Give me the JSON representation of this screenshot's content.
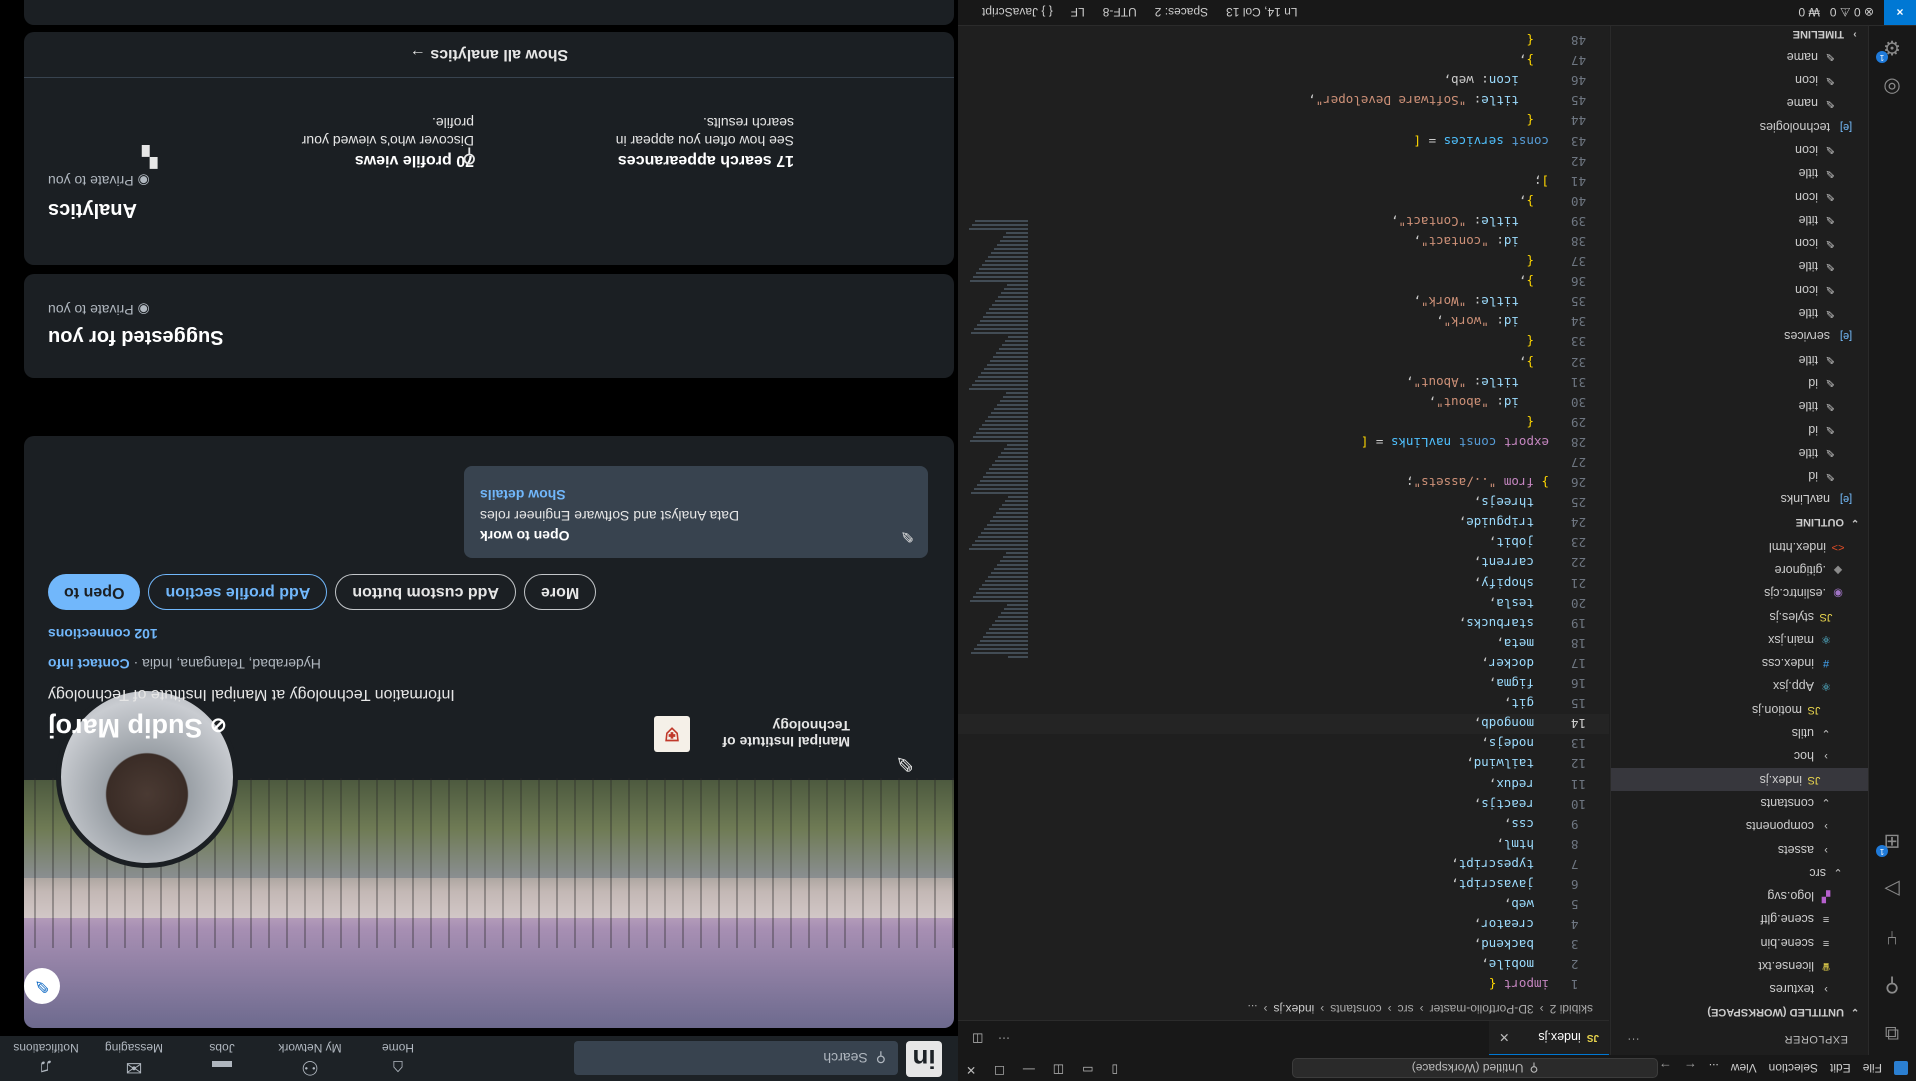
{
  "vscode": {
    "menu": [
      "File",
      "Edit",
      "Selection",
      "View",
      "..."
    ],
    "search_text": "Untitled (Workspace)",
    "explorer_title": "EXPLORER",
    "workspace_title": "UNTITLED (WORKSPACE)",
    "file_tree": [
      {
        "label": "textures",
        "icon": "chevron-right",
        "indent": 2
      },
      {
        "label": "license.txt",
        "icon": "license-icon",
        "indent": 2
      },
      {
        "label": "scene.bin",
        "icon": "file-lines-icon",
        "indent": 2
      },
      {
        "label": "scene.gltf",
        "icon": "file-lines-icon",
        "indent": 2
      },
      {
        "label": "logo.svg",
        "icon": "svg-icon",
        "indent": 2
      },
      {
        "label": "src",
        "icon": "chevron-down",
        "indent": 1
      },
      {
        "label": "assets",
        "icon": "chevron-right",
        "indent": 2
      },
      {
        "label": "components",
        "icon": "chevron-right",
        "indent": 2
      },
      {
        "label": "constants",
        "icon": "chevron-down",
        "indent": 2
      },
      {
        "label": "index.js",
        "icon": "js-icon",
        "indent": 3,
        "selected": true
      },
      {
        "label": "hoc",
        "icon": "chevron-right",
        "indent": 2
      },
      {
        "label": "utils",
        "icon": "chevron-down",
        "indent": 2
      },
      {
        "label": "motion.js",
        "icon": "js-icon",
        "indent": 3
      },
      {
        "label": "App.jsx",
        "icon": "react-icon",
        "indent": 2
      },
      {
        "label": "index.css",
        "icon": "css-icon",
        "indent": 2
      },
      {
        "label": "main.jsx",
        "icon": "react-icon",
        "indent": 2
      },
      {
        "label": "styles.js",
        "icon": "js-icon",
        "indent": 2
      },
      {
        "label": ".eslintrc.cjs",
        "icon": "eslint-icon",
        "indent": 1
      },
      {
        "label": ".gitignore",
        "icon": "git-icon",
        "indent": 1
      },
      {
        "label": "index.html",
        "icon": "html-icon",
        "indent": 1
      }
    ],
    "outline_title": "OUTLINE",
    "outline": [
      {
        "label": "navLinks",
        "type": "group"
      },
      {
        "label": "id"
      },
      {
        "label": "title"
      },
      {
        "label": "id"
      },
      {
        "label": "title"
      },
      {
        "label": "id"
      },
      {
        "label": "title"
      },
      {
        "label": "services",
        "type": "group"
      },
      {
        "label": "title"
      },
      {
        "label": "icon"
      },
      {
        "label": "title"
      },
      {
        "label": "icon"
      },
      {
        "label": "title"
      },
      {
        "label": "icon"
      },
      {
        "label": "title"
      },
      {
        "label": "icon"
      },
      {
        "label": "technologies",
        "type": "group"
      },
      {
        "label": "name"
      },
      {
        "label": "icon"
      },
      {
        "label": "name"
      }
    ],
    "timeline_title": "TIMELINE",
    "tab_label": "index.js",
    "tab_type": "JS",
    "breadcrumb": [
      "skibidi 2",
      "3D-Portfolio-master",
      "src",
      "constants",
      "index.js",
      "..."
    ],
    "code_lines": [
      {
        "n": "1",
        "code": "import {"
      },
      {
        "n": "2",
        "code": "  mobile,"
      },
      {
        "n": "3",
        "code": "  backend,"
      },
      {
        "n": "4",
        "code": "  creator,"
      },
      {
        "n": "5",
        "code": "  web,"
      },
      {
        "n": "6",
        "code": "  javascript,"
      },
      {
        "n": "7",
        "code": "  typescript,"
      },
      {
        "n": "8",
        "code": "  html,"
      },
      {
        "n": "9",
        "code": "  css,"
      },
      {
        "n": "10",
        "code": "  reactjs,"
      },
      {
        "n": "11",
        "code": "  redux,"
      },
      {
        "n": "12",
        "code": "  tailwind,"
      },
      {
        "n": "13",
        "code": "  nodejs,"
      },
      {
        "n": "14",
        "code": "  mongodb,",
        "current": true
      },
      {
        "n": "15",
        "code": "  git,"
      },
      {
        "n": "16",
        "code": "  figma,"
      },
      {
        "n": "17",
        "code": "  docker,"
      },
      {
        "n": "18",
        "code": "  meta,"
      },
      {
        "n": "19",
        "code": "  starbucks,"
      },
      {
        "n": "20",
        "code": "  tesla,"
      },
      {
        "n": "21",
        "code": "  shopify,"
      },
      {
        "n": "22",
        "code": "  carrent,"
      },
      {
        "n": "23",
        "code": "  jobit,"
      },
      {
        "n": "24",
        "code": "  tripguide,"
      },
      {
        "n": "25",
        "code": "  threejs,"
      },
      {
        "n": "26",
        "code": "} from \"../assets\";"
      },
      {
        "n": "27",
        "code": ""
      },
      {
        "n": "28",
        "code": "export const navLinks = ["
      },
      {
        "n": "29",
        "code": "  {"
      },
      {
        "n": "30",
        "code": "    id: \"about\","
      },
      {
        "n": "31",
        "code": "    title: \"About\","
      },
      {
        "n": "32",
        "code": "  },"
      },
      {
        "n": "33",
        "code": "  {"
      },
      {
        "n": "34",
        "code": "    id: \"work\","
      },
      {
        "n": "35",
        "code": "    title: \"Work\","
      },
      {
        "n": "36",
        "code": "  },"
      },
      {
        "n": "37",
        "code": "  {"
      },
      {
        "n": "38",
        "code": "    id: \"contact\","
      },
      {
        "n": "39",
        "code": "    title: \"Contact\","
      },
      {
        "n": "40",
        "code": "  },"
      },
      {
        "n": "41",
        "code": "];"
      },
      {
        "n": "42",
        "code": ""
      },
      {
        "n": "43",
        "code": "const services = ["
      },
      {
        "n": "44",
        "code": "  {"
      },
      {
        "n": "45",
        "code": "    title: \"Software Developer\","
      },
      {
        "n": "46",
        "code": "    icon: web,"
      },
      {
        "n": "47",
        "code": "  },"
      },
      {
        "n": "48",
        "code": "  {"
      }
    ],
    "status": {
      "problems": "⊗ 0 ⚠ 0",
      "ports": "₩ 0",
      "position": "Ln 14, Col 13",
      "spaces": "Spaces: 2",
      "encoding": "UTF-8",
      "eol": "LF",
      "language": "{ } JavaScript"
    }
  },
  "linkedin": {
    "search_placeholder": "Search",
    "nav": [
      "Home",
      "My Network",
      "Jobs",
      "Messaging",
      "Notifications"
    ],
    "profile": {
      "name": "Sudip Maroj",
      "headline": "Information Technology at Manipal Institute of Technology",
      "location": "Hyderabad, Telangana, India · ",
      "contact_link": "Contact info",
      "connections": "102 connections",
      "school": "Manipal Institute of Technology"
    },
    "buttons": {
      "open_to": "Open to",
      "add_section": "Add profile section",
      "add_custom": "Add custom button",
      "more": "More"
    },
    "open_to_work": {
      "title": "Open to work",
      "detail": "Data Analyst and Software Engineer roles",
      "link": "Show details"
    },
    "suggested": {
      "title": "Suggested for you",
      "private": "Private to you"
    },
    "analytics": {
      "title": "Analytics",
      "private": "Private to you",
      "items": [
        {
          "heading": "70 profile views",
          "desc1": "Discover who's viewed your",
          "desc2": "profile."
        },
        {
          "heading": "17 search appearances",
          "desc1": "See how often you appear in",
          "desc2": "search results."
        }
      ],
      "show_all": "Show all analytics →"
    }
  }
}
